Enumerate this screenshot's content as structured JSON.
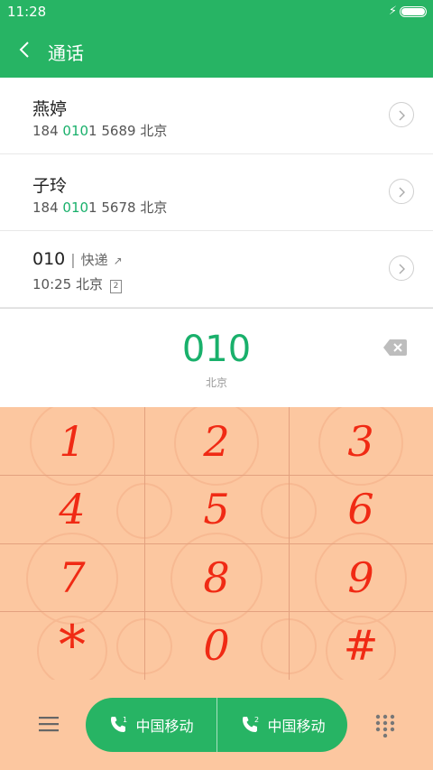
{
  "status_bar": {
    "time": "11:28",
    "battery_level": 1.0,
    "charging_icon": "bolt-icon"
  },
  "app_bar": {
    "title": "通话",
    "back_icon": "back-arrow-icon"
  },
  "results": [
    {
      "name": "燕婷",
      "num_pre": "184 ",
      "num_match": "010",
      "num_post": "1 5689",
      "location": "北京"
    },
    {
      "name": "子玲",
      "num_pre": "184 ",
      "num_match": "010",
      "num_post": "1 5678",
      "location": "北京"
    },
    {
      "name": "010",
      "separator": "|",
      "tag": "快递",
      "time": "10:25",
      "location": "北京",
      "sim": "2"
    }
  ],
  "dialer": {
    "number": "010",
    "region": "北京",
    "keys": [
      "1",
      "2",
      "3",
      "4",
      "5",
      "6",
      "7",
      "8",
      "9",
      "*",
      "0",
      "#"
    ]
  },
  "bottom_bar": {
    "sim1_label": "中国移动",
    "sim2_label": "中国移动",
    "sim1_badge": "1",
    "sim2_badge": "2"
  },
  "colors": {
    "accent": "#27b464",
    "match": "#19b06b",
    "keypad_bg": "#fcc7a0",
    "key_digit": "#f02a14"
  }
}
